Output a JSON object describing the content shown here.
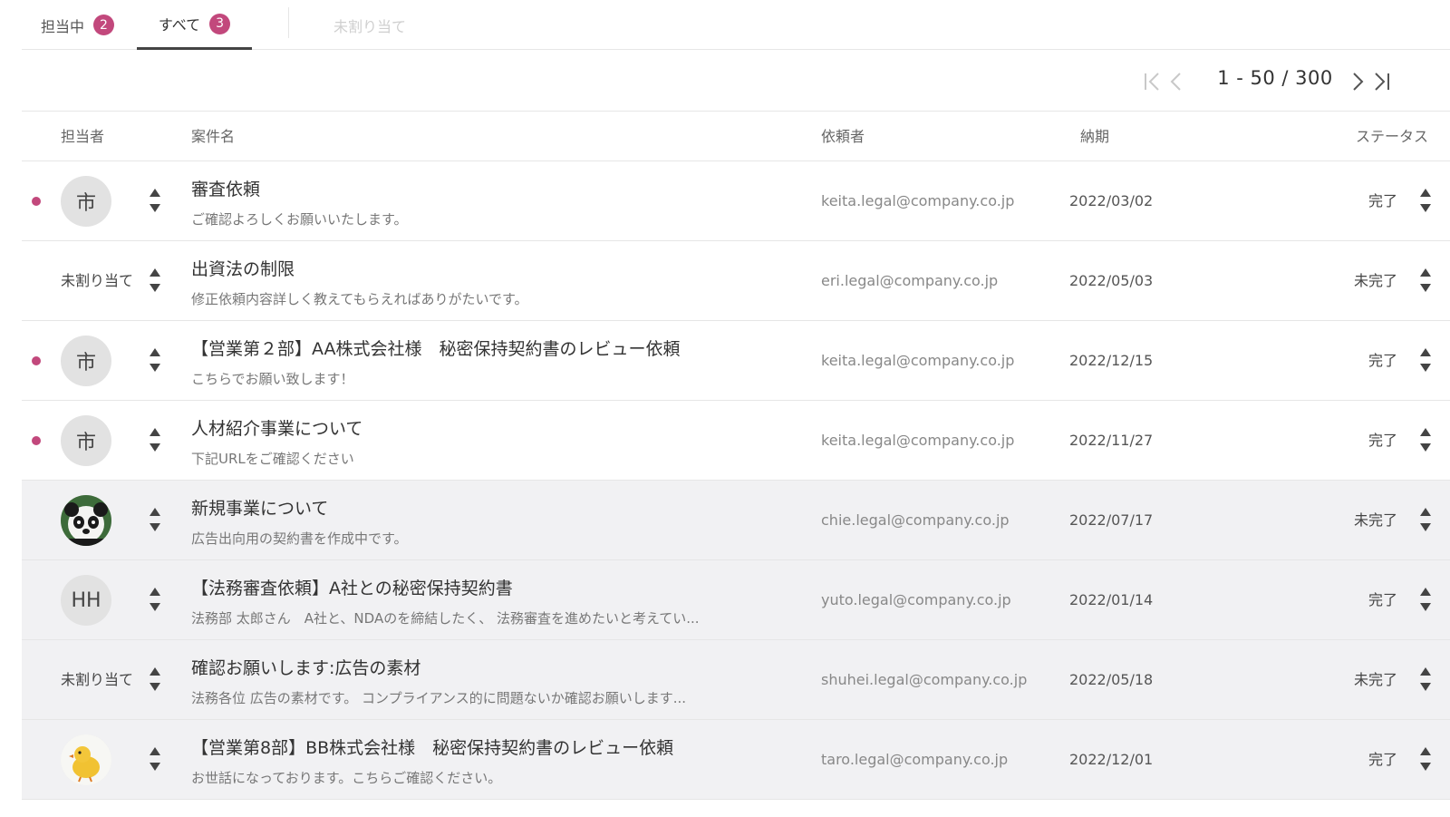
{
  "tabs": [
    {
      "label": "担当中",
      "count": "2"
    },
    {
      "label": "すべて",
      "count": "3"
    },
    {
      "label": "未割り当て"
    }
  ],
  "pagination": {
    "range": "1 - 50 / 300"
  },
  "columns": {
    "assignee": "担当者",
    "subject": "案件名",
    "requester": "依頼者",
    "due": "納期",
    "status": "ステータス"
  },
  "rows": [
    {
      "assignee": "市",
      "avatar_type": "initial",
      "unread": true,
      "title": "審査依頼",
      "desc": "ご確認よろしくお願いいたします。",
      "email": "keita.legal@company.co.jp",
      "date": "2022/03/02",
      "status": "完了"
    },
    {
      "assignee": "未割り当て",
      "avatar_type": "none",
      "unread": false,
      "title": "出資法の制限",
      "desc": "修正依頼内容詳しく教えてもらえればありがたいです。",
      "email": "eri.legal@company.co.jp",
      "date": "2022/05/03",
      "status": "未完了"
    },
    {
      "assignee": "市",
      "avatar_type": "initial",
      "unread": true,
      "title": "【営業第２部】AA株式会社様　秘密保持契約書のレビュー依頼",
      "desc": "こちらでお願い致します！",
      "email": "keita.legal@company.co.jp",
      "date": "2022/12/15",
      "status": "完了"
    },
    {
      "assignee": "市",
      "avatar_type": "initial",
      "unread": true,
      "title": "人材紹介事業について",
      "desc": "下記URLをご確認ください",
      "email": "keita.legal@company.co.jp",
      "date": "2022/11/27",
      "status": "完了"
    },
    {
      "assignee": "",
      "avatar_type": "panda",
      "unread": false,
      "title": "新規事業について",
      "desc": "広告出向用の契約書を作成中です。",
      "email": "chie.legal@company.co.jp",
      "date": "2022/07/17",
      "status": "未完了"
    },
    {
      "assignee": "HH",
      "avatar_type": "initial",
      "unread": false,
      "title": "【法務審査依頼】A社との秘密保持契約書",
      "desc": "法務部 太郎さん　A社と、NDAのを締結したく、 法務審査を進めたいと考えてい...",
      "email": "yuto.legal@company.co.jp",
      "date": "2022/01/14",
      "status": "完了"
    },
    {
      "assignee": "未割り当て",
      "avatar_type": "none",
      "unread": false,
      "title": "確認お願いします:広告の素材",
      "desc": "法務各位 広告の素材です。 コンプライアンス的に問題ないか確認お願いします...",
      "email": "shuhei.legal@company.co.jp",
      "date": "2022/05/18",
      "status": "未完了"
    },
    {
      "assignee": "",
      "avatar_type": "chick",
      "unread": false,
      "title": "【営業第8部】BB株式会社様　秘密保持契約書のレビュー依頼",
      "desc": "お世話になっております。こちらご確認ください。",
      "email": "taro.legal@company.co.jp",
      "date": "2022/12/01",
      "status": "完了"
    }
  ],
  "colors": {
    "accent": "#c2487c",
    "row_alt": "#f1f1f3",
    "border": "#e6e6e6"
  }
}
